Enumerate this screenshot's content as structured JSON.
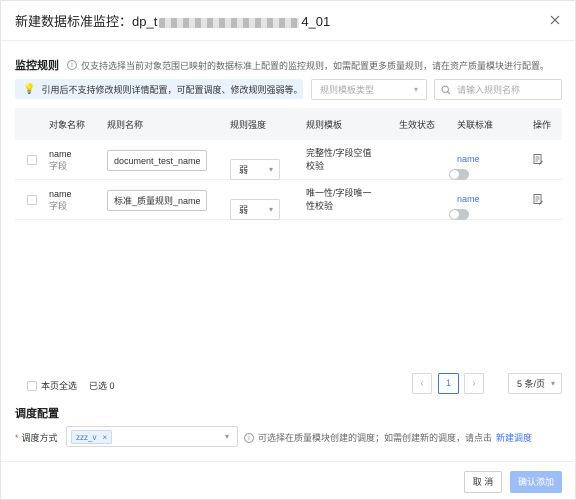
{
  "dialog": {
    "title_prefix": "新建数据标准监控：dp_t",
    "title_suffix": "4_01"
  },
  "monitor_rules": {
    "title": "监控规则",
    "hint": "仅支持选择当前对象范围已映射的数据标准上配置的监控规则，如需配置更多质量规则，请在资产质量模块进行配置。",
    "notice": "引用后不支持修改规则详情配置，可配置调度、修改规则强弱等。",
    "template_type_placeholder": "规则模板类型",
    "search_placeholder": "请输入规则名称"
  },
  "table": {
    "headers": {
      "object_name": "对象名称",
      "rule_name": "规则名称",
      "strength": "规则强度",
      "template": "规则模板",
      "status": "生效状态",
      "standard": "关联标准",
      "action": "操作"
    },
    "rows": [
      {
        "object_name": "name",
        "object_type": "字段",
        "rule_name": "document_test_name",
        "strength": "弱",
        "template_line1": "完整性/字段空值",
        "template_line2": "校验",
        "enabled": false,
        "standard": "name"
      },
      {
        "object_name": "name",
        "object_type": "字段",
        "rule_name": "标准_质量规则_name_",
        "strength": "弱",
        "template_line1": "唯一性/字段唯一",
        "template_line2": "性校验",
        "enabled": false,
        "standard": "name"
      }
    ]
  },
  "pagination": {
    "select_all_label": "本页全选",
    "selected_label": "已选 0",
    "current_page": "1",
    "page_size": "5 条/页"
  },
  "schedule": {
    "title": "调度配置",
    "label": "调度方式",
    "selected_tag": "zzz_v",
    "hint": "可选择在质量模块创建的调度；如需创建新的调度，请点击",
    "link": "新建调度"
  },
  "footer": {
    "cancel": "取 消",
    "confirm": "确认添加"
  },
  "colors": {
    "accent": "#3a78f2",
    "notice_bg": "#eaf2fe",
    "confirm_disabled": "#9dbdf7"
  }
}
